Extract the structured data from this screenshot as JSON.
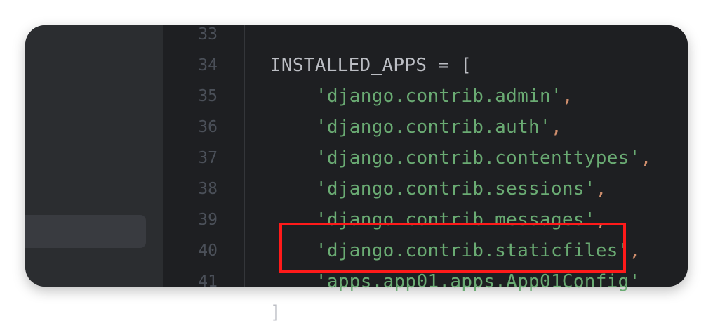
{
  "editor": {
    "lines": [
      {
        "number": "33",
        "text": "INSTALLED_APPS = [",
        "indent": "",
        "suffix": ""
      },
      {
        "number": "34",
        "text": "'django.contrib.admin'",
        "indent": "    ",
        "suffix": ","
      },
      {
        "number": "35",
        "text": "'django.contrib.auth'",
        "indent": "    ",
        "suffix": ","
      },
      {
        "number": "36",
        "text": "'django.contrib.contenttypes'",
        "indent": "    ",
        "suffix": ","
      },
      {
        "number": "37",
        "text": "'django.contrib.sessions'",
        "indent": "    ",
        "suffix": ","
      },
      {
        "number": "38",
        "text": "'django.contrib.messages'",
        "indent": "    ",
        "suffix": ","
      },
      {
        "number": "39",
        "text": "'django.contrib.staticfiles'",
        "indent": "    ",
        "suffix": ","
      },
      {
        "number": "40",
        "text": "'apps.app01.apps.App01Config'",
        "indent": "    ",
        "suffix": ""
      },
      {
        "number": "41",
        "text": "]",
        "indent": "",
        "suffix": ""
      }
    ]
  },
  "colors": {
    "background": "#1e1f22",
    "sidebar": "#2b2d30",
    "string": "#6aab73",
    "comma": "#cf8e6d",
    "default_text": "#bcbec4",
    "line_number": "#4b5059",
    "highlight_border": "#ff1a1a"
  }
}
